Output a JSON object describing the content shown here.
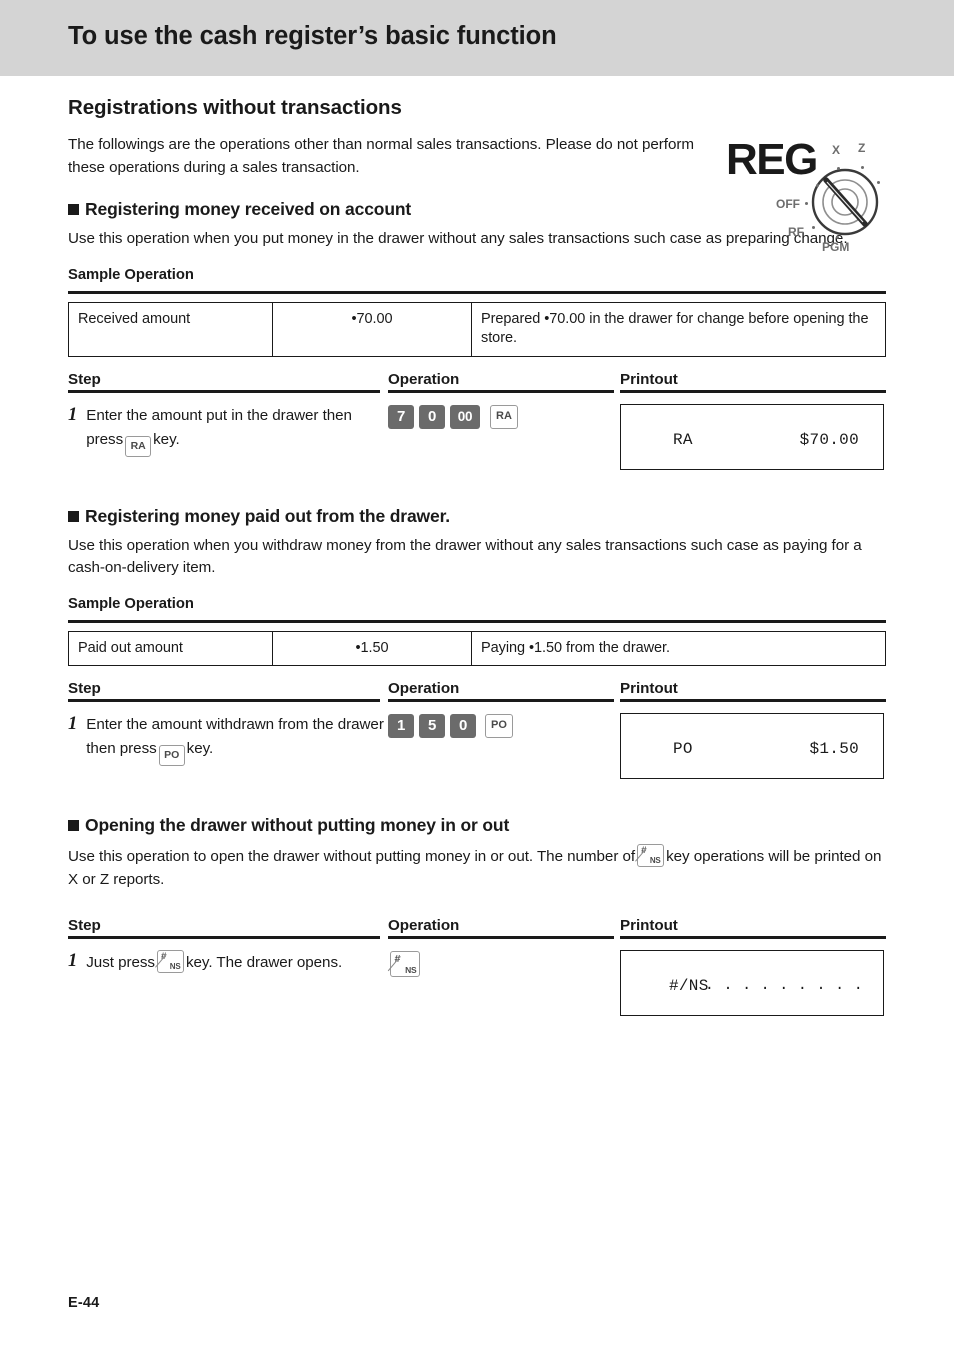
{
  "header": {
    "title": "To use the cash register’s basic function"
  },
  "section": {
    "title": "Registrations without transactions",
    "intro": "The followings are the operations other than normal sales transactions. Please do not perform these operations during a sales transaction."
  },
  "dial": {
    "reg_label": "REG",
    "x_label": "X",
    "z_label": "Z",
    "off_label": "OFF",
    "rf_label": "RF",
    "pgm_label": "PGM"
  },
  "labels": {
    "sample_operation": "Sample Operation",
    "step": "Step",
    "operation": "Operation",
    "printout": "Printout"
  },
  "topics": [
    {
      "heading": "Registering money received on account",
      "description": "Use this operation when you put money in the drawer without any sales transactions such case as preparing change.",
      "table": {
        "row_label": "Received amount",
        "row_value": "•70.00",
        "row_desc": "Prepared •70.00 in the drawer for change before opening the store."
      },
      "step": {
        "number": "1",
        "text_before": "Enter the amount put in the drawer then press",
        "inline_key": "RA",
        "text_after": "key.",
        "operation_keys": [
          "7",
          "0",
          "00"
        ],
        "operation_fn_key": "RA"
      },
      "printout": {
        "left": "RA",
        "right": "$70.00"
      }
    },
    {
      "heading": "Registering money paid out from the drawer.",
      "description": "Use this operation when you withdraw money from the drawer without any sales transactions such case as paying for a cash-on-delivery item.",
      "table": {
        "row_label": "Paid out amount",
        "row_value": "•1.50",
        "row_desc": "Paying •1.50 from the drawer."
      },
      "step": {
        "number": "1",
        "text_before": "Enter the amount withdrawn from the drawer then press",
        "inline_key": "PO",
        "text_after": "key.",
        "operation_keys": [
          "1",
          "5",
          "0"
        ],
        "operation_fn_key": "PO"
      },
      "printout": {
        "left": "PO",
        "right": "$1.50"
      }
    },
    {
      "heading": "Opening the drawer without putting money in or out",
      "description_before": "Use this operation to open the drawer without putting money in or out. The number of",
      "description_after": "key operations will be printed on X or Z reports.",
      "ns_key_hash": "#",
      "ns_key_ns": "NS",
      "step": {
        "number": "1",
        "text_before": "Just press",
        "text_after": "key. The drawer opens."
      },
      "printout": {
        "left": "#/NS",
        "right": ". . . . . . . . ."
      }
    }
  ],
  "footer": {
    "page_number": "E-44"
  }
}
